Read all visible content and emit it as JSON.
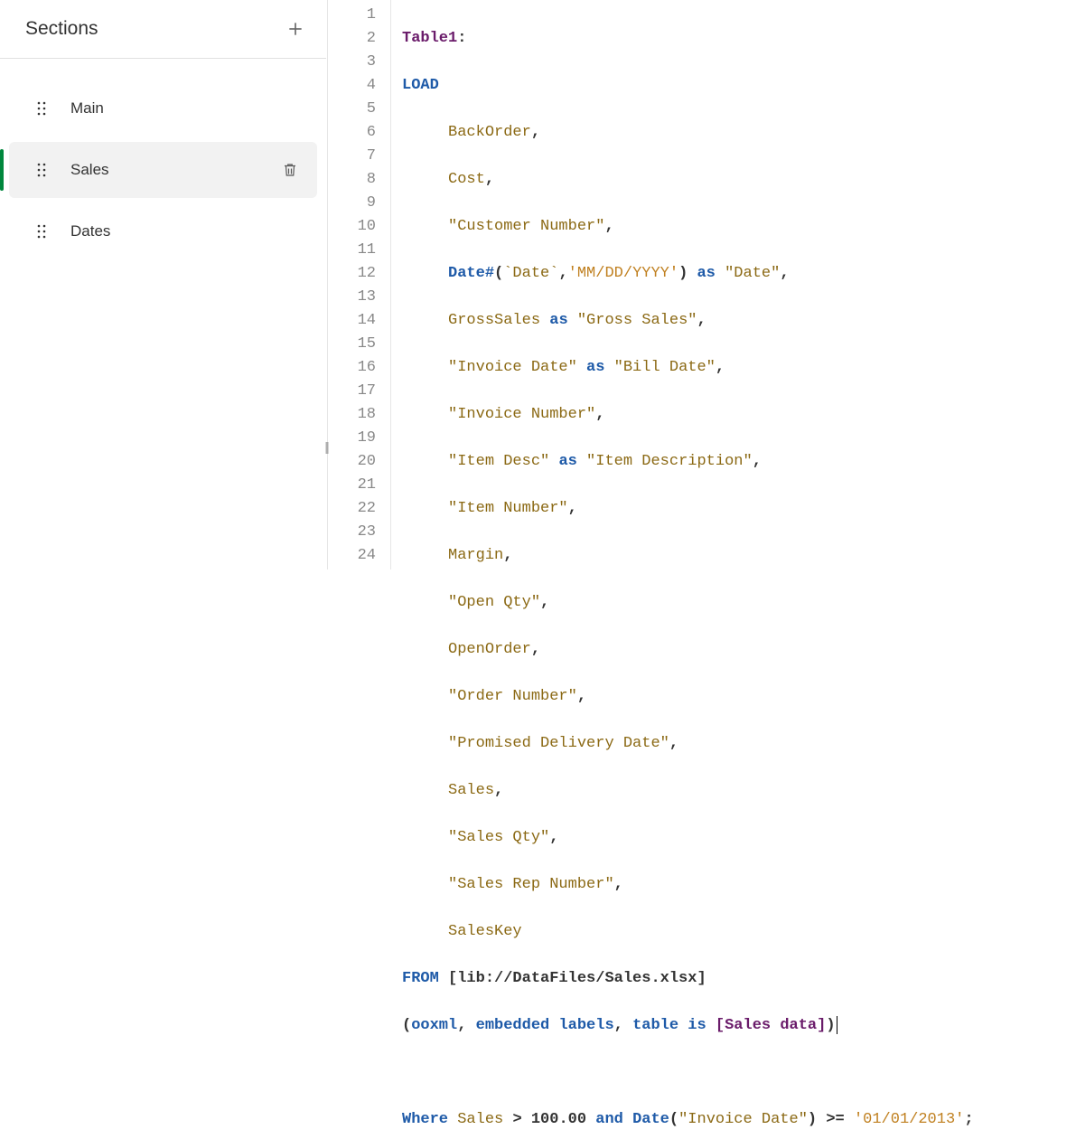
{
  "sidebar": {
    "title": "Sections",
    "items": [
      {
        "label": "Main",
        "active": false
      },
      {
        "label": "Sales",
        "active": true
      },
      {
        "label": "Dates",
        "active": false
      }
    ]
  },
  "editor": {
    "line_count": 24,
    "lines": {
      "l1_table": "Table1",
      "l2_load": "LOAD",
      "l3_field": "BackOrder",
      "l4_field": "Cost",
      "l5_field": "\"Customer Number\"",
      "l6_func": "Date#",
      "l6_arg1": "`Date`",
      "l6_arg2": "'MM/DD/YYYY'",
      "l6_as": "as",
      "l6_alias": "\"Date\"",
      "l7_field": "GrossSales",
      "l7_as": "as",
      "l7_alias": "\"Gross Sales\"",
      "l8_field": "\"Invoice Date\"",
      "l8_as": "as",
      "l8_alias": "\"Bill Date\"",
      "l9_field": "\"Invoice Number\"",
      "l10_field": "\"Item Desc\"",
      "l10_as": "as",
      "l10_alias": "\"Item Description\"",
      "l11_field": "\"Item Number\"",
      "l12_field": "Margin",
      "l13_field": "\"Open Qty\"",
      "l14_field": "OpenOrder",
      "l15_field": "\"Order Number\"",
      "l16_field": "\"Promised Delivery Date\"",
      "l17_field": "Sales",
      "l18_field": "\"Sales Qty\"",
      "l19_field": "\"Sales Rep Number\"",
      "l20_field": "SalesKey",
      "l21_from": "FROM",
      "l21_path": "[lib://DataFiles/Sales.xlsx]",
      "l22_o1": "ooxml",
      "l22_o2": "embedded",
      "l22_o3": "labels",
      "l22_o4": "table",
      "l22_o5": "is",
      "l22_tbl": "[Sales data]",
      "l24_where": "Where",
      "l24_f1": "Sales",
      "l24_op1": ">",
      "l24_v1": "100.00",
      "l24_and": "and",
      "l24_func": "Date",
      "l24_arg": "\"Invoice Date\"",
      "l24_op2": ">=",
      "l24_v2": "'01/01/2013'"
    }
  }
}
